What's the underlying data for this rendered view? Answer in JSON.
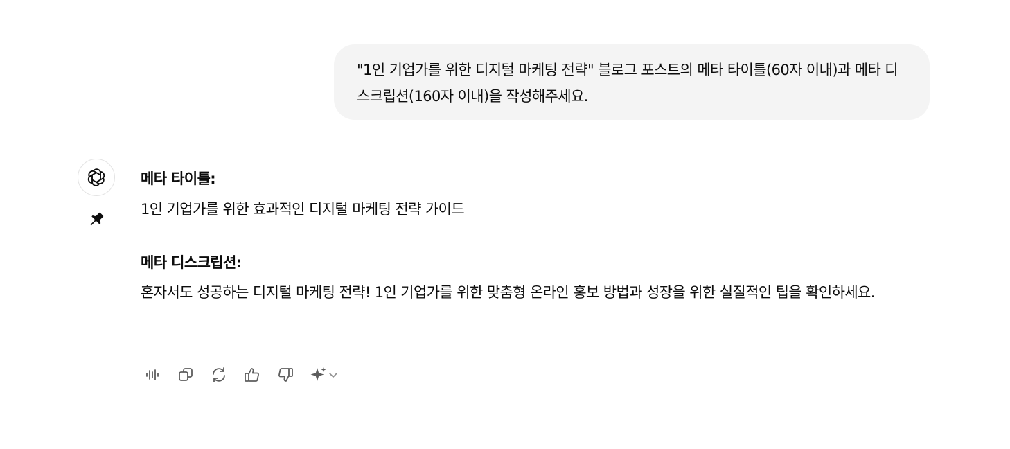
{
  "conversation": {
    "user_message": {
      "text": "\"1인 기업가를 위한 디지털 마케팅 전략\" 블로그 포스트의 메타 타이틀(60자 이내)과 메타 디스크립션(160자 이내)을 작성해주세요."
    },
    "assistant_message": {
      "avatar_icon": "openai-logo-icon",
      "pin_icon": "pin-icon",
      "meta_title_heading": "메타 타이틀:",
      "meta_title_value": "1인 기업가를 위한 효과적인 디지털 마케팅 전략 가이드",
      "meta_description_heading": "메타 디스크립션:",
      "meta_description_value": "혼자서도 성공하는 디지털 마케팅 전략! 1인 기업가를 위한 맞춤형 온라인 홍보 방법과 성장을 위한 실질적인 팁을 확인하세요."
    },
    "action_bar": {
      "icons": [
        "read-aloud-icon",
        "copy-icon",
        "regenerate-icon",
        "thumbs-up-icon",
        "thumbs-down-icon",
        "sparkle-icon",
        "chevron-down-icon"
      ]
    }
  },
  "colors": {
    "user_bubble_bg": "#f4f4f4",
    "text": "#0d0d0d",
    "icon": "#5d5d5d"
  }
}
